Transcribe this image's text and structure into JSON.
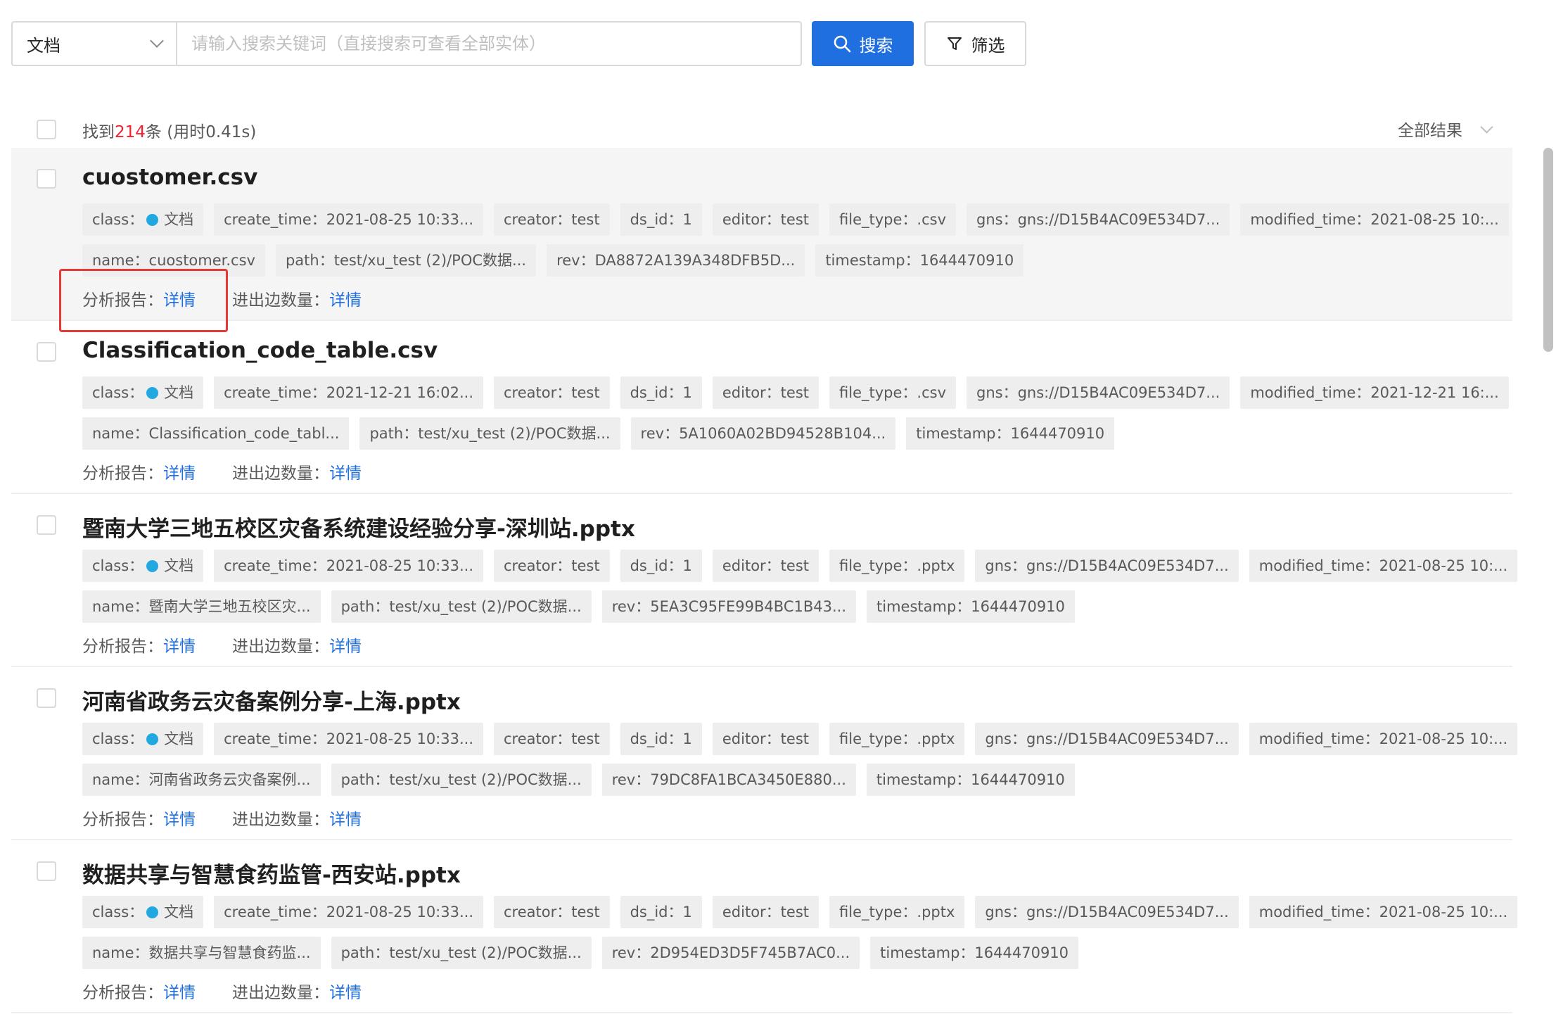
{
  "search": {
    "type_value": "文档",
    "placeholder": "请输入搜索关键词（直接搜索可查看全部实体）",
    "search_label": "搜索",
    "filter_label": "筛选"
  },
  "summary": {
    "prefix": "找到",
    "count": "214",
    "suffix": "条 (用时0.41s)",
    "all_results": "全部结果"
  },
  "link_labels": {
    "report": "分析报告：",
    "edges": "进出边数量：",
    "detail": "详情"
  },
  "colors": {
    "primary": "#1f6fe0",
    "count_red": "#f5222d",
    "class_dot": "#22a8e0",
    "highlight": "#e53935"
  },
  "results": [
    {
      "title": "cuostomer.csv",
      "class": "class：",
      "class_value": "文档",
      "row1": [
        "create_time：2021-08-25 10:33...",
        "creator：test",
        "ds_id：1",
        "editor：test",
        "file_type：.csv",
        "gns：gns://D15B4AC09E534D7...",
        "modified_time：2021-08-25 10:..."
      ],
      "row2": [
        "name：cuostomer.csv",
        "path：test/xu_test (2)/POC数据...",
        "rev：DA8872A139A348DFB5D...",
        "timestamp：1644470910"
      ]
    },
    {
      "title": "Classification_code_table.csv",
      "class": "class：",
      "class_value": "文档",
      "row1": [
        "create_time：2021-12-21 16:02...",
        "creator：test",
        "ds_id：1",
        "editor：test",
        "file_type：.csv",
        "gns：gns://D15B4AC09E534D7...",
        "modified_time：2021-12-21 16:..."
      ],
      "row2": [
        "name：Classification_code_tabl...",
        "path：test/xu_test (2)/POC数据...",
        "rev：5A1060A02BD94528B104...",
        "timestamp：1644470910"
      ]
    },
    {
      "title": "暨南大学三地五校区灾备系统建设经验分享-深圳站.pptx",
      "class": "class：",
      "class_value": "文档",
      "row1": [
        "create_time：2021-08-25 10:33...",
        "creator：test",
        "ds_id：1",
        "editor：test",
        "file_type：.pptx",
        "gns：gns://D15B4AC09E534D7...",
        "modified_time：2021-08-25 10:..."
      ],
      "row2": [
        "name：暨南大学三地五校区灾...",
        "path：test/xu_test (2)/POC数据...",
        "rev：5EA3C95FE99B4BC1B43...",
        "timestamp：1644470910"
      ]
    },
    {
      "title": "河南省政务云灾备案例分享-上海.pptx",
      "class": "class：",
      "class_value": "文档",
      "row1": [
        "create_time：2021-08-25 10:33...",
        "creator：test",
        "ds_id：1",
        "editor：test",
        "file_type：.pptx",
        "gns：gns://D15B4AC09E534D7...",
        "modified_time：2021-08-25 10:..."
      ],
      "row2": [
        "name：河南省政务云灾备案例...",
        "path：test/xu_test (2)/POC数据...",
        "rev：79DC8FA1BCA3450E880...",
        "timestamp：1644470910"
      ]
    },
    {
      "title": "数据共享与智慧食药监管-西安站.pptx",
      "class": "class：",
      "class_value": "文档",
      "row1": [
        "create_time：2021-08-25 10:33...",
        "creator：test",
        "ds_id：1",
        "editor：test",
        "file_type：.pptx",
        "gns：gns://D15B4AC09E534D7...",
        "modified_time：2021-08-25 10:..."
      ],
      "row2": [
        "name：数据共享与智慧食药监...",
        "path：test/xu_test (2)/POC数据...",
        "rev：2D954ED3D5F745B7AC0...",
        "timestamp：1644470910"
      ]
    }
  ]
}
